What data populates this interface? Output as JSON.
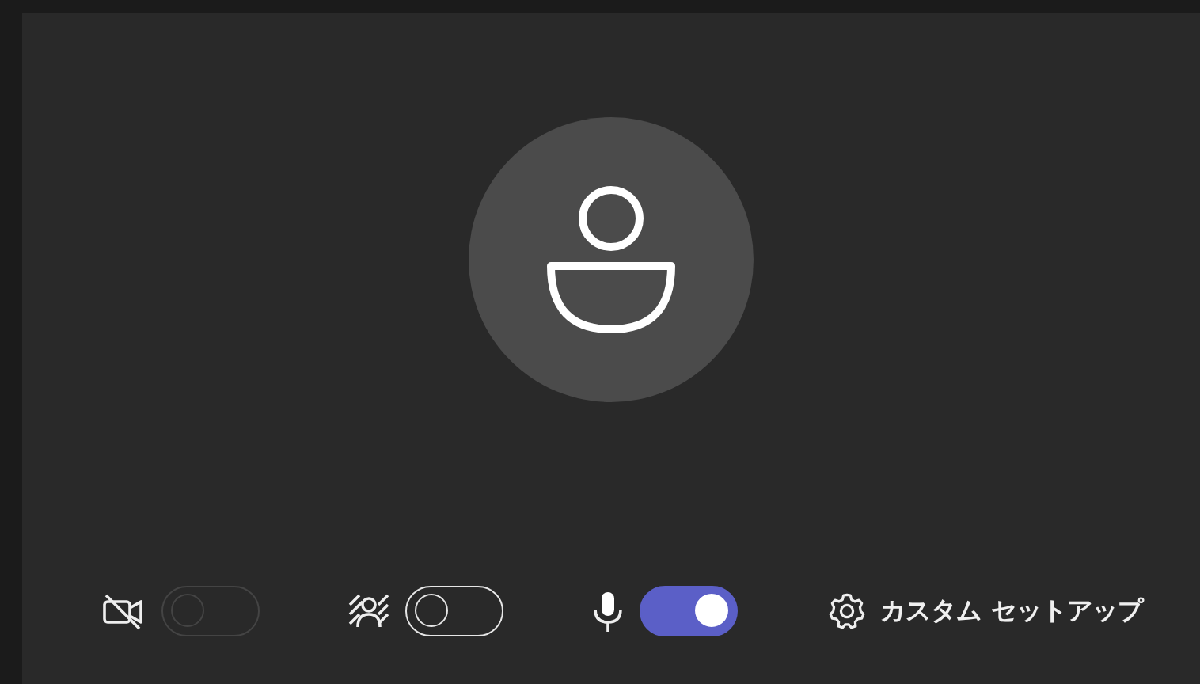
{
  "toggles": [
    {
      "kind": "camera",
      "on": false,
      "disabled": true
    },
    {
      "kind": "background",
      "on": false,
      "disabled": false
    },
    {
      "kind": "mic",
      "on": true,
      "disabled": false
    }
  ],
  "settings_button": {
    "label": "カスタム セットアップ"
  }
}
